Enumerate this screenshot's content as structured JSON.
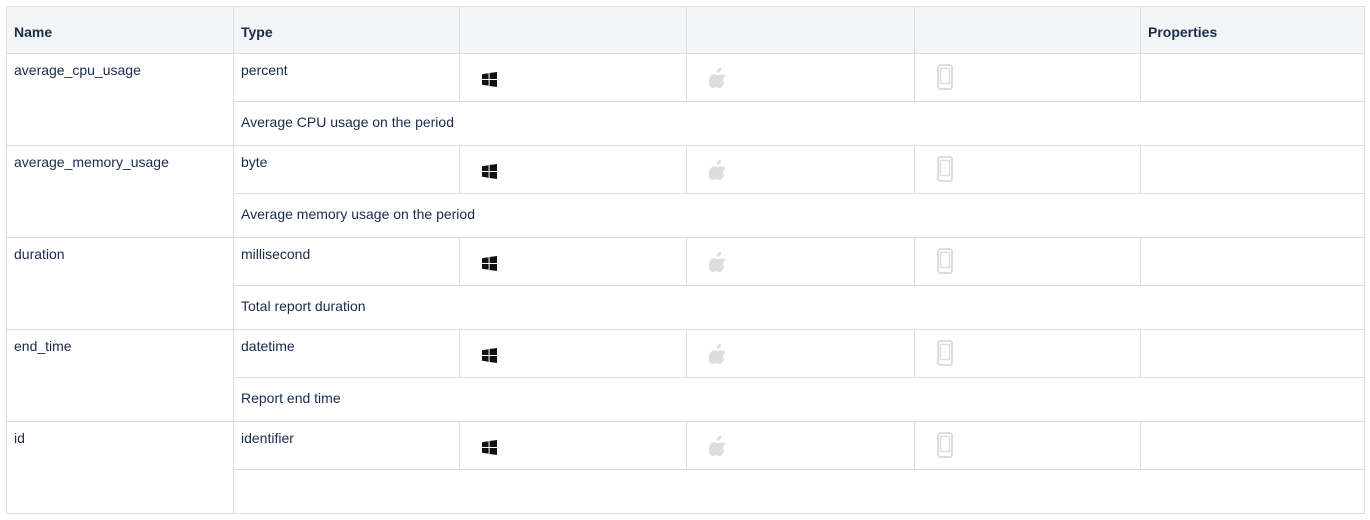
{
  "table": {
    "headers": [
      "Name",
      "Type",
      "",
      "",
      "",
      "Properties"
    ],
    "rows": [
      {
        "name": "average_cpu_usage",
        "type": "percent",
        "description": "Average CPU usage on the period",
        "platforms": {
          "windows": true,
          "mac": false,
          "mobile": false
        }
      },
      {
        "name": "average_memory_usage",
        "type": "byte",
        "description": "Average memory usage on the period",
        "platforms": {
          "windows": true,
          "mac": false,
          "mobile": false
        }
      },
      {
        "name": "duration",
        "type": "millisecond",
        "description": "Total report duration",
        "platforms": {
          "windows": true,
          "mac": false,
          "mobile": false
        }
      },
      {
        "name": "end_time",
        "type": "datetime",
        "description": "Report end time",
        "platforms": {
          "windows": true,
          "mac": false,
          "mobile": false
        }
      },
      {
        "name": "id",
        "type": "identifier",
        "description": "",
        "platforms": {
          "windows": true,
          "mac": false,
          "mobile": false
        }
      }
    ]
  },
  "icons": {
    "windows": "windows-icon",
    "mac": "apple-icon",
    "mobile": "mobile-device-icon"
  },
  "colors": {
    "header_bg": "#f4f5f7",
    "border": "#dddddd",
    "supported_icon": "#111111",
    "unsupported_icon": "#dddddd"
  }
}
